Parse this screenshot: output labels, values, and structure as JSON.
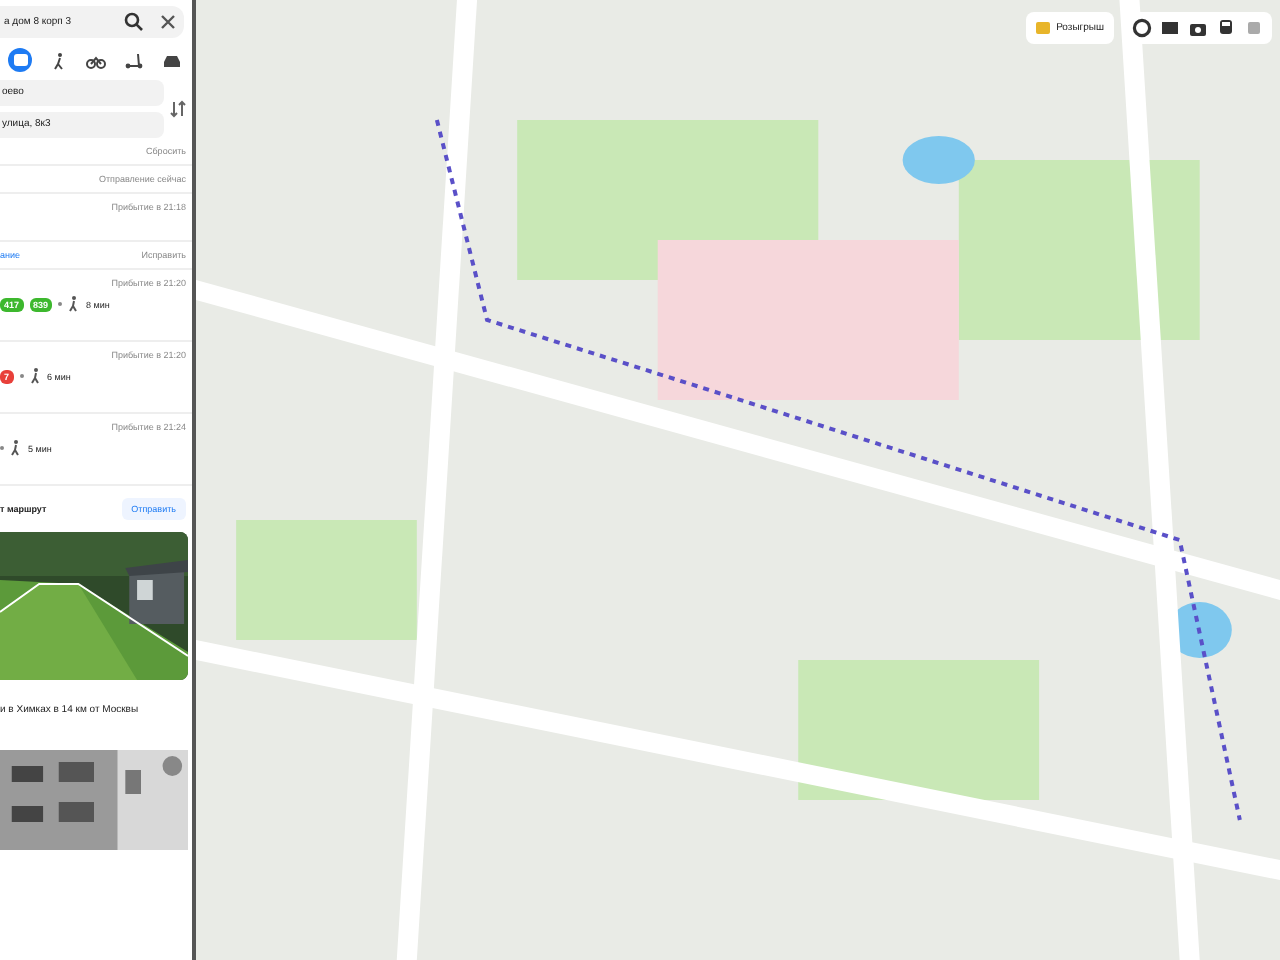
{
  "search": {
    "value": "а дом 8 корп 3"
  },
  "modes": [
    {
      "kind": "transit",
      "selected": true
    },
    {
      "kind": "walk",
      "selected": false
    },
    {
      "kind": "bike",
      "selected": false
    },
    {
      "kind": "scooter",
      "selected": false
    },
    {
      "kind": "car",
      "selected": false
    }
  ],
  "route": {
    "from": "оево",
    "to": "улица, 8к3",
    "reset": "Сбросить",
    "departure": "Отправление сейчас",
    "arrival": "Прибытие в 21:18",
    "link": "ание",
    "fix": "Исправить"
  },
  "options": [
    {
      "arrival": "Прибытие в 21:20",
      "badges": [
        {
          "text": "417",
          "color": "#3db82e"
        },
        {
          "text": "839",
          "color": "#3db82e"
        }
      ],
      "walk": "8 мин"
    },
    {
      "arrival": "Прибытие в 21:20",
      "badges": [
        {
          "text": "7",
          "color": "#e8403a"
        }
      ],
      "walk": "6 мин"
    },
    {
      "arrival": "Прибытие в 21:24",
      "walk": "5 мин"
    }
  ],
  "send": {
    "label": "т маршрут",
    "button": "Отправить"
  },
  "ad": {
    "caption": "и в Химках в 14 км от Москвы"
  },
  "toolbar": {
    "promo": "Розыгрыш"
  }
}
